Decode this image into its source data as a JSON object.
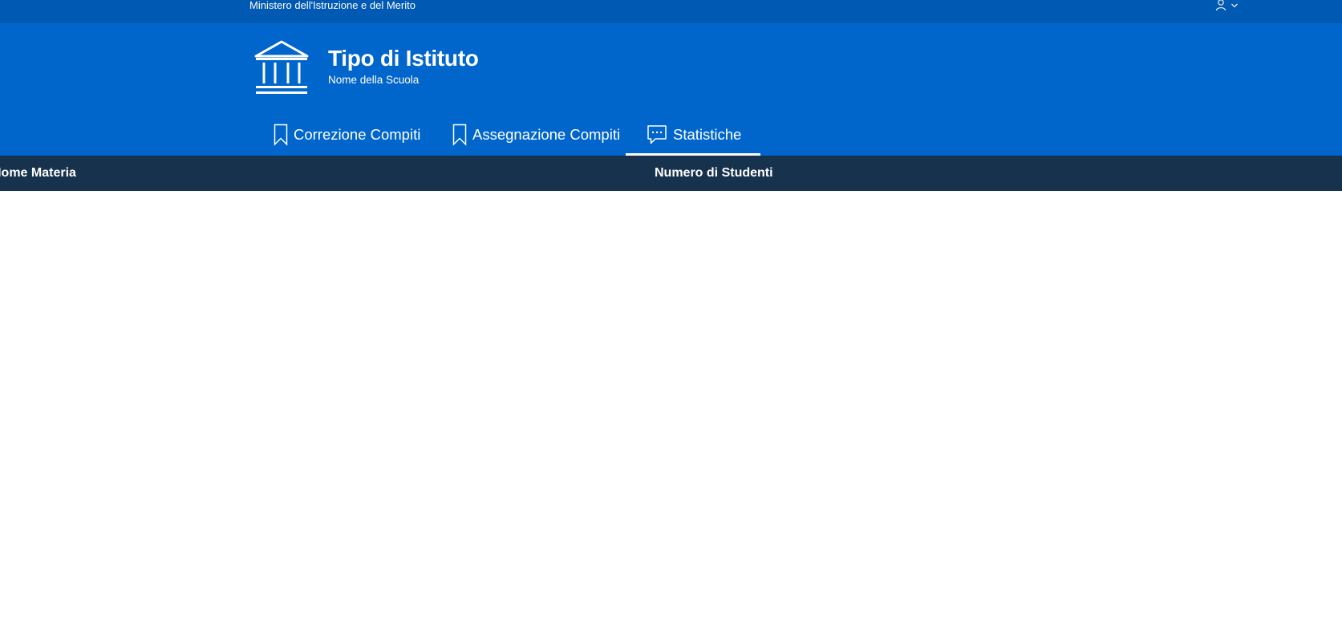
{
  "topbar": {
    "ministry": "Ministero dell'Istruzione e del Merito",
    "user_icon": "user-icon",
    "chevron_icon": "chevron-down-icon"
  },
  "brand": {
    "title": "Tipo di Istituto",
    "subtitle": "Nome della Scuola",
    "logo_icon": "institution-icon"
  },
  "nav": {
    "items": [
      {
        "label": "Correzione Compiti",
        "icon": "bookmark-icon",
        "active": false
      },
      {
        "label": "Assegnazione Compiti",
        "icon": "bookmark-icon",
        "active": false
      },
      {
        "label": "Statistiche",
        "icon": "chat-icon",
        "active": true
      }
    ]
  },
  "table": {
    "columns": [
      "Nome Materia",
      "Numero di Studenti"
    ],
    "rows": []
  },
  "colors": {
    "topbar": "#0059b3",
    "header": "#0066cc",
    "table_header": "#17324d",
    "text": "#ffffff"
  }
}
